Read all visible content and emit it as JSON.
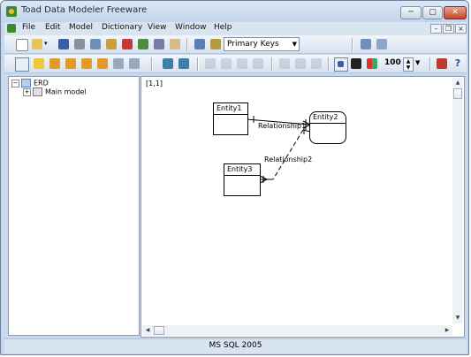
{
  "window": {
    "title": "Toad Data Modeler Freeware",
    "minimize": "─",
    "maximize": "▢",
    "close": "✕"
  },
  "menubar": {
    "items": [
      "File",
      "Edit",
      "Model",
      "Dictionary",
      "View",
      "Window",
      "Help"
    ],
    "mdi_minimize": "–",
    "mdi_restore": "❐",
    "mdi_close": "×"
  },
  "toolbar1": {
    "keys_combo": "Primary Keys"
  },
  "toolbar2": {
    "zoom": "100"
  },
  "tree": {
    "root": "ERD",
    "child": "Main model",
    "root_toggle": "−",
    "child_toggle": "+"
  },
  "canvas": {
    "coords": "[1,1]",
    "entities": [
      "Entity1",
      "Entity2",
      "Entity3"
    ],
    "relationships": [
      "Relationship1",
      "Relationship2"
    ]
  },
  "status": {
    "text": "MS SQL 2005"
  },
  "colors": {
    "accent": "#c9d9ed",
    "close": "#c8442c"
  }
}
